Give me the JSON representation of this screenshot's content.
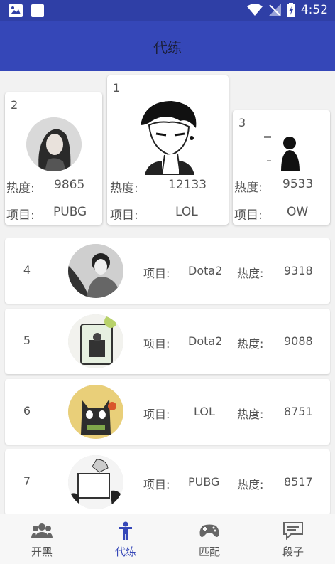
{
  "status_bar": {
    "time": "4:52"
  },
  "app_bar": {
    "title": "代练"
  },
  "labels": {
    "heat": "热度:",
    "project": "项目:"
  },
  "podium": [
    {
      "rank": "2",
      "heat": "9865",
      "project": "PUBG"
    },
    {
      "rank": "1",
      "heat": "12133",
      "project": "LOL"
    },
    {
      "rank": "3",
      "heat": "9533",
      "project": "OW"
    }
  ],
  "list": [
    {
      "rank": "4",
      "project": "Dota2",
      "heat": "9318"
    },
    {
      "rank": "5",
      "project": "Dota2",
      "heat": "9088"
    },
    {
      "rank": "6",
      "project": "LOL",
      "heat": "8751"
    },
    {
      "rank": "7",
      "project": "PUBG",
      "heat": "8517"
    }
  ],
  "bottom_nav": [
    {
      "label": "开黑",
      "icon": "group-icon"
    },
    {
      "label": "代练",
      "icon": "person-icon",
      "active": true
    },
    {
      "label": "匹配",
      "icon": "gamepad-icon"
    },
    {
      "label": "段子",
      "icon": "chat-icon"
    }
  ],
  "colors": {
    "primary": "#3547b8",
    "status_bar": "#2f3fa6"
  }
}
